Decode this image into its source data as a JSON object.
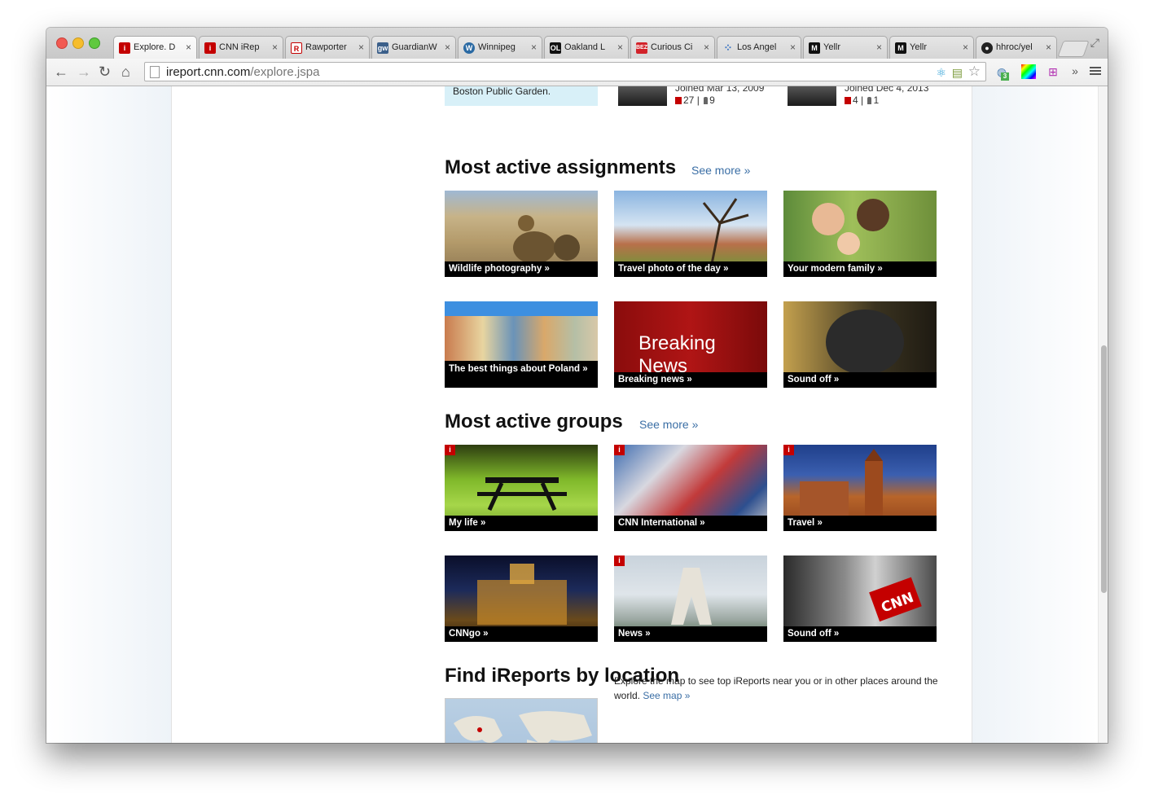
{
  "browser": {
    "tabs": [
      {
        "label": "Explore. D",
        "active": true,
        "favicon": "ireport-icon"
      },
      {
        "label": "CNN iRep",
        "favicon": "ireport-icon"
      },
      {
        "label": "Rawporter",
        "favicon": "rawporter-icon"
      },
      {
        "label": "GuardianW",
        "favicon": "guardian-witness-icon"
      },
      {
        "label": "Winnipeg",
        "favicon": "wordpress-icon"
      },
      {
        "label": "Oakland L",
        "favicon": "oakland-local-icon"
      },
      {
        "label": "Curious Ci",
        "favicon": "wbez-icon"
      },
      {
        "label": "Los Angel",
        "favicon": "la-icon"
      },
      {
        "label": "Yellr",
        "favicon": "yellr-icon"
      },
      {
        "label": "Yellr",
        "favicon": "yellr-icon"
      },
      {
        "label": "hhroc/yel",
        "favicon": "github-icon"
      }
    ],
    "tab_close": "×",
    "url_host": "ireport.cnn.com",
    "url_path": "/explore.jspa",
    "nav": {
      "back": "←",
      "forward": "→",
      "reload": "↻",
      "home": "⌂"
    },
    "star": "☆",
    "overflow": "»",
    "ext_badge": "3"
  },
  "top_strip": {
    "story_text": "Boston Public Garden.",
    "members": [
      {
        "joined": "Joined Mar 13, 2009",
        "reports": "27",
        "followers": "9"
      },
      {
        "joined": "Joined Dec 4, 2013",
        "reports": "4",
        "followers": "1"
      }
    ]
  },
  "assignments": {
    "title": "Most active assignments",
    "see_more": "See more »",
    "tiles": [
      {
        "label": "Wildlife photography  »"
      },
      {
        "label": "Travel photo of the day  »"
      },
      {
        "label": "Your modern family  »"
      },
      {
        "label": "The best things about Poland  »"
      },
      {
        "label": "Breaking news  »",
        "image_text": "Breaking News"
      },
      {
        "label": "Sound off  »"
      }
    ]
  },
  "groups": {
    "title": "Most active groups",
    "see_more": "See more »",
    "badge": "i",
    "tiles": [
      {
        "label": "My life  »"
      },
      {
        "label": "CNN International  »"
      },
      {
        "label": "Travel  »"
      },
      {
        "label": "CNNgo  »"
      },
      {
        "label": "News  »"
      },
      {
        "label": "Sound off  »"
      }
    ]
  },
  "location": {
    "title": "Find iReports by location",
    "text": "Explore the map to see top iReports near you or in other places around the world.",
    "link": "See map »"
  },
  "colors": {
    "link": "#3a6ea5",
    "cnn_red": "#c40000",
    "caption_bg": "#000000",
    "story_box": "#d8f0f8"
  }
}
